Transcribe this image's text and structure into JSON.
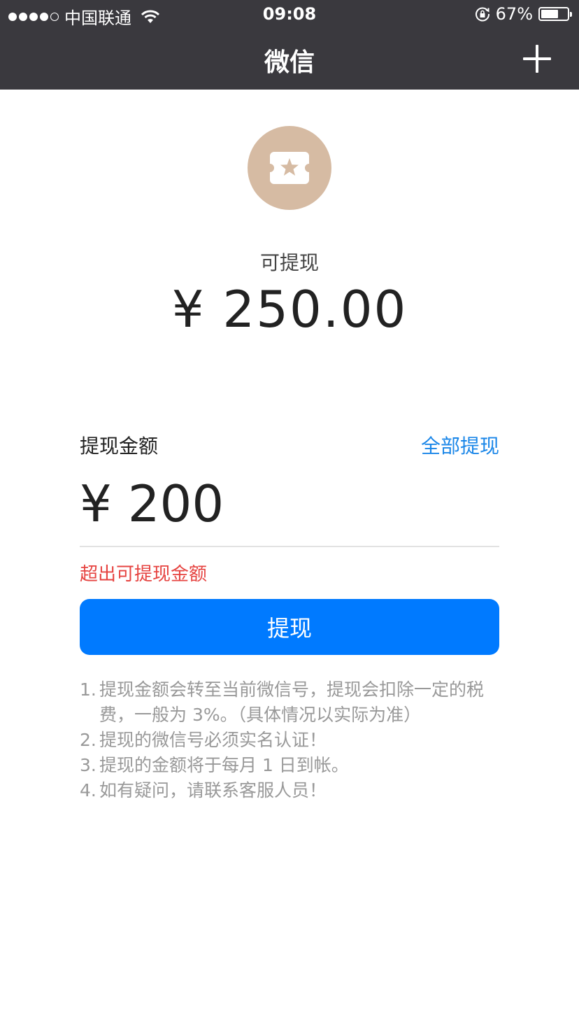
{
  "status_bar": {
    "carrier": "中国联通",
    "time": "09:08",
    "battery_percent": "67%",
    "battery_level": 0.67,
    "signal_icon": "signal-dots-icon",
    "wifi_icon": "wifi-icon",
    "rotation_lock_icon": "rotation-lock-icon"
  },
  "nav": {
    "title": "微信",
    "add_icon": "plus-icon"
  },
  "wallet": {
    "icon": "ticket-star-icon",
    "icon_bg_color": "#d6bba3",
    "available_label": "可提现",
    "available_amount": "¥ 250.00"
  },
  "withdraw": {
    "amount_label": "提现金额",
    "withdraw_all_label": "全部提现",
    "amount_value": "¥ 200",
    "error_text": "超出可提现金额",
    "button_label": "提现",
    "accent_color": "#007aff",
    "error_color": "#e64340"
  },
  "notes": [
    {
      "num": "1.",
      "text": "提现金额会转至当前微信号，提现会扣除一定的税费，一般为 3%。（具体情况以实际为准）"
    },
    {
      "num": "2.",
      "text": "提现的微信号必须实名认证！"
    },
    {
      "num": "3.",
      "text": "提现的金额将于每月 1 日到帐。"
    },
    {
      "num": "4.",
      "text": "如有疑问，请联系客服人员！"
    }
  ]
}
